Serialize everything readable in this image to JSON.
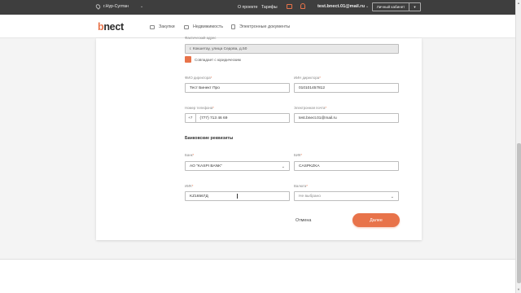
{
  "topbar": {
    "city": "г.Нур-Султан",
    "about": "О проекте",
    "tariffs": "Тарифы",
    "email": "test.bnect.01@mail.ru",
    "cabinet": "Личный кабинет"
  },
  "header": {
    "logo_b": "b",
    "logo_rest": "nect",
    "nav": [
      "Закупки",
      "Недвижимость",
      "Электронные документы"
    ]
  },
  "form": {
    "address_label": "Фактический адрес",
    "address_value": "г. Кокшетау, улица Седова, д.50",
    "same_checkbox_label": "Совпадает с юридическим",
    "director_label": "ФИО директора",
    "director_value": "Тест Бинект Про",
    "iin_label": "ИИН директора",
    "iin_value": "010101457812",
    "phone_label": "Номер телефона",
    "phone_prefix": "+7",
    "phone_value": "(777) 713 46 69",
    "email_label": "Электронная почта",
    "email_value": "test.bnect.01@mail.ru",
    "bank_section": "Банковские реквизиты",
    "bank_label": "Банк",
    "bank_value": "АО \"KASPI BANK\"",
    "bik_label": "БИК",
    "bik_value": "CASPKZKA",
    "iik_label": "ИИК",
    "iik_value": "KZ16567Д",
    "currency_label": "Валюта",
    "currency_value": "Не выбрано",
    "cancel": "Отмена",
    "next": "Далее",
    "required_mark": "*"
  },
  "colors": {
    "accent": "#e8734a",
    "topbar": "#3e3e3e"
  }
}
